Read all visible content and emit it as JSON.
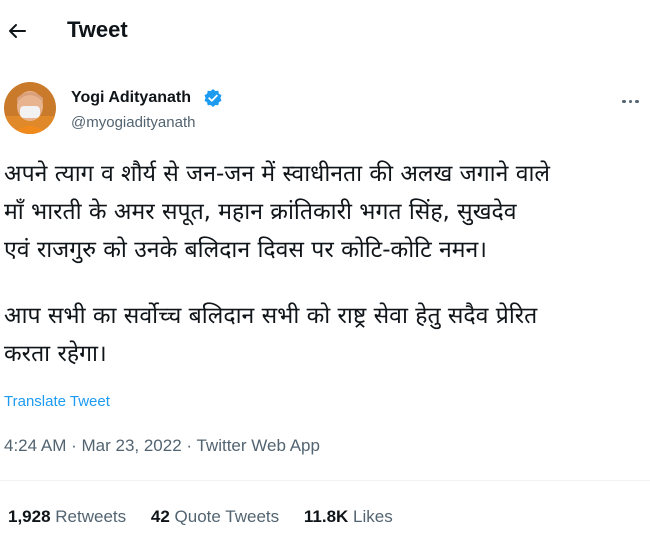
{
  "header": {
    "title": "Tweet"
  },
  "author": {
    "name": "Yogi Adityanath",
    "handle": "@myogiadityanath",
    "verified": true
  },
  "tweet": {
    "paragraphs": [
      "अपने त्याग व शौर्य से जन-जन में स्वाधीनता की अलख जगाने वाले\nमाँ भारती के अमर सपूत, महान क्रांतिकारी भगत सिंह, सुखदेव\nएवं राजगुरु को उनके बलिदान दिवस पर कोटि-कोटि नमन।",
      "आप सभी का सर्वोच्च बलिदान सभी को राष्ट्र सेवा हेतु सदैव प्रेरित\nकरता रहेगा।"
    ],
    "translate_label": "Translate Tweet",
    "time": "4:24 AM",
    "date": "Mar 23, 2022",
    "source": "Twitter Web App",
    "separator": " · "
  },
  "stats": {
    "retweets_count": "1,928",
    "retweets_label": "Retweets",
    "quotes_count": "42",
    "quotes_label": "Quote Tweets",
    "likes_count": "11.8K",
    "likes_label": "Likes"
  },
  "colors": {
    "accent": "#1d9bf0",
    "text_primary": "#0f1419",
    "text_secondary": "#536471"
  }
}
